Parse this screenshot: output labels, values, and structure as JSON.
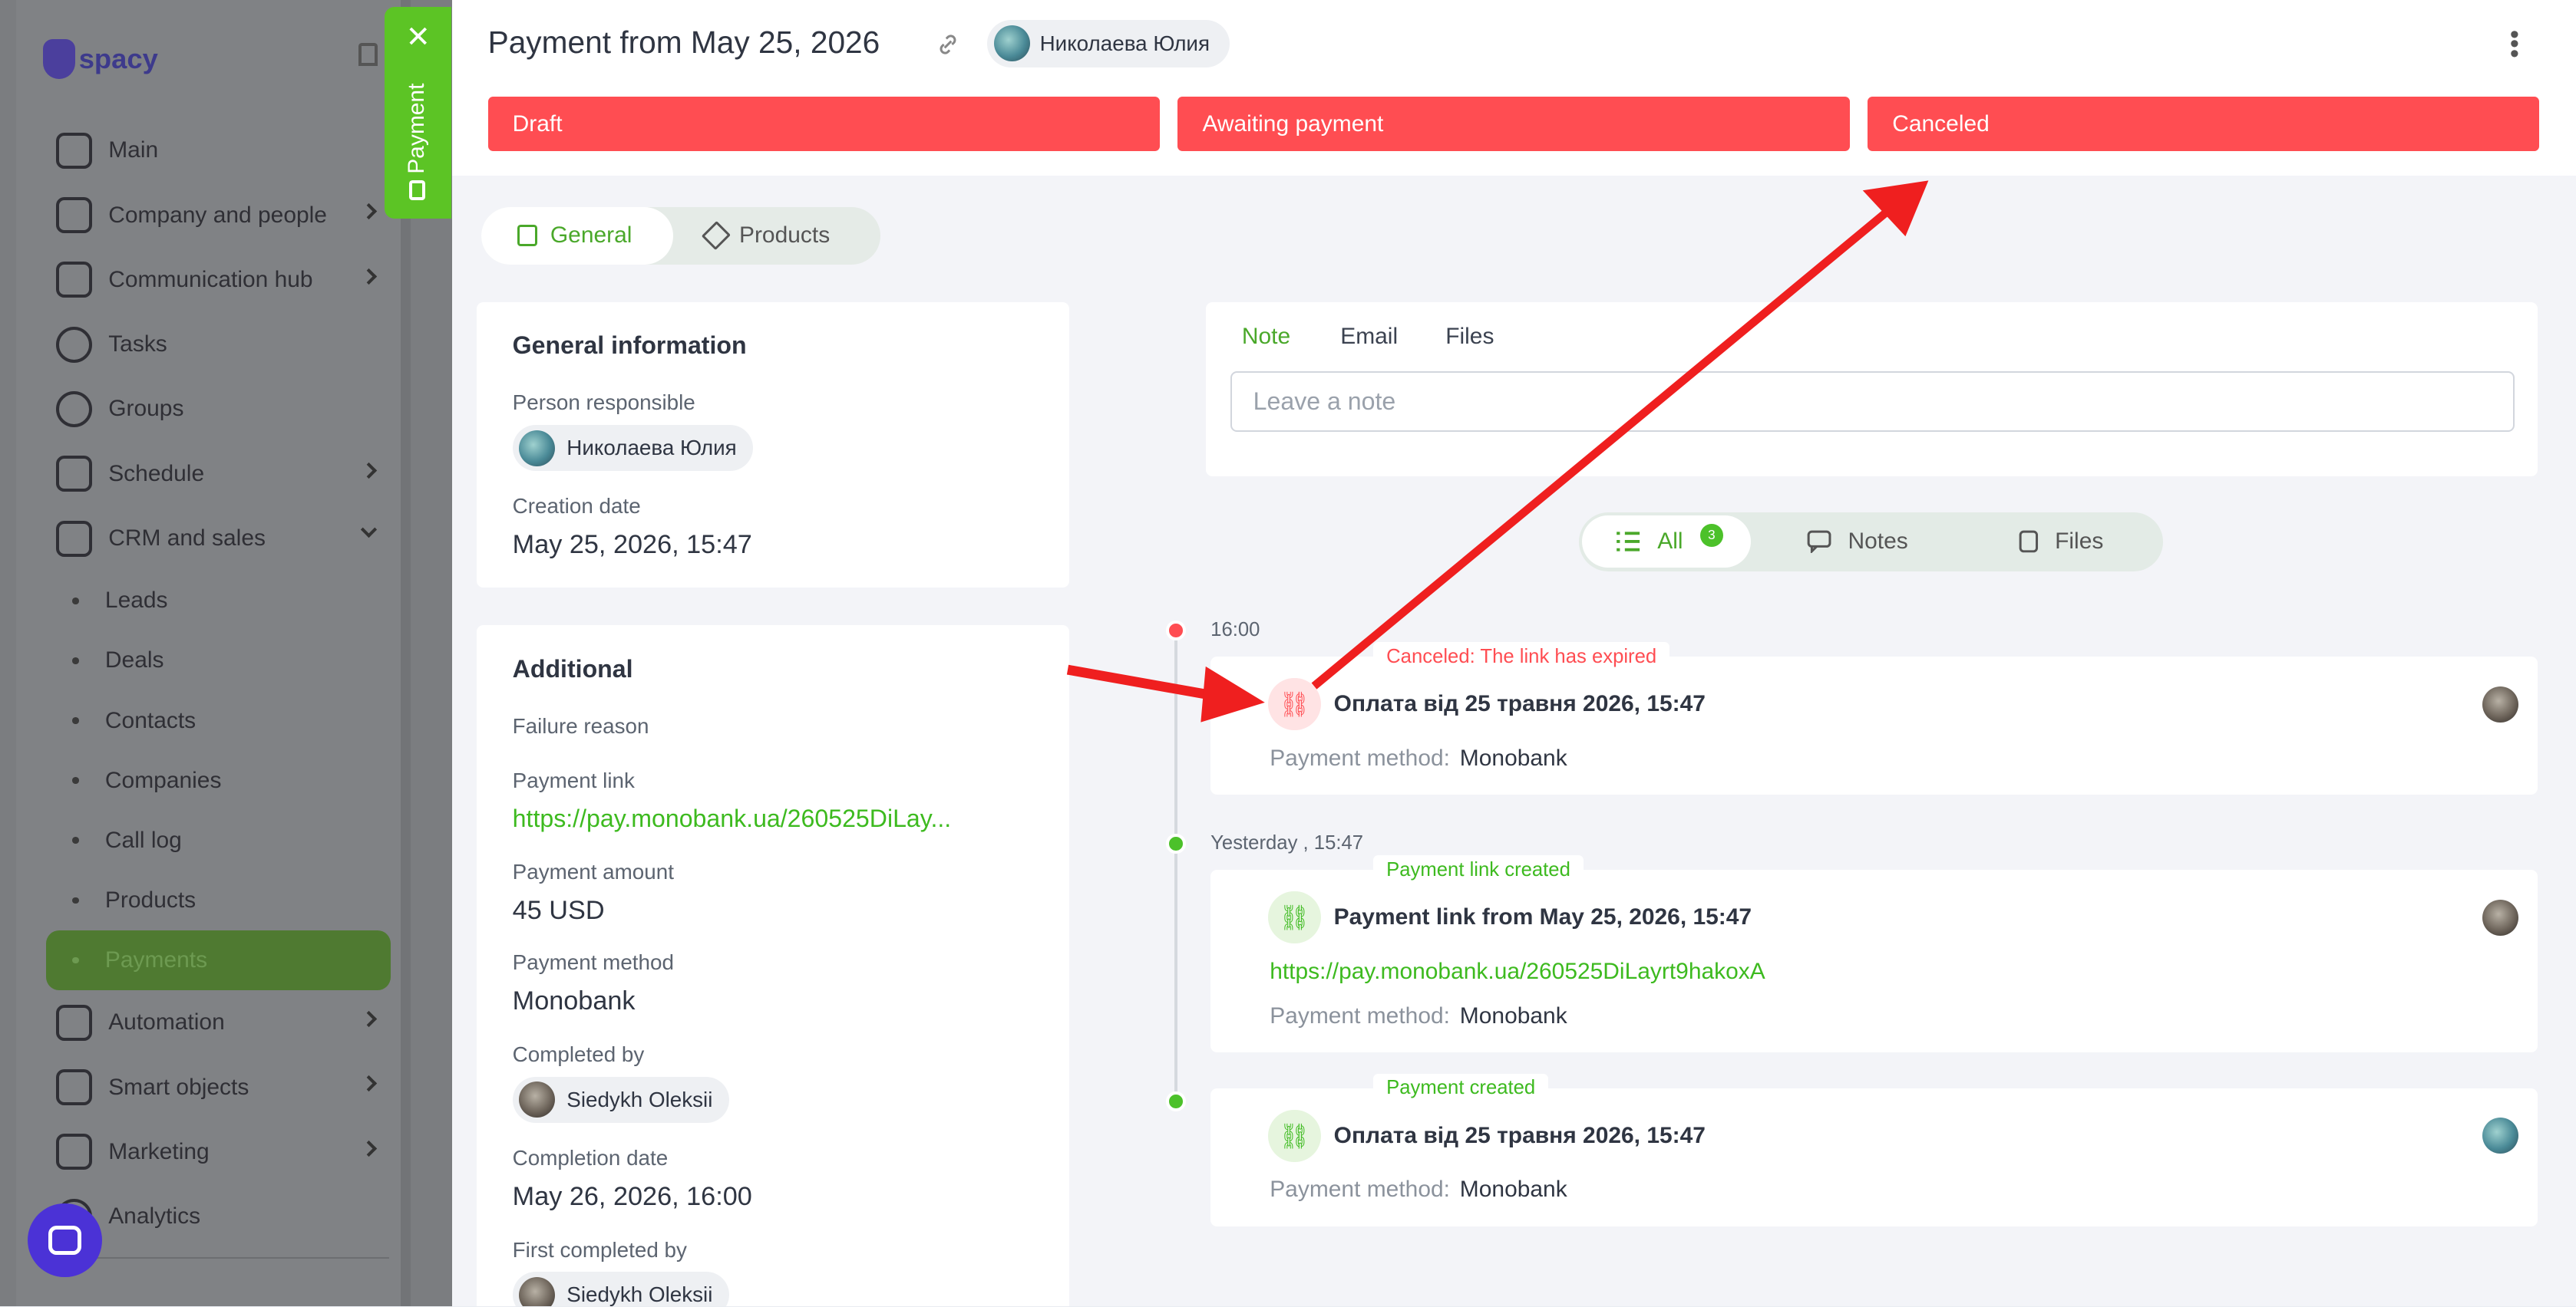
{
  "sidebar": {
    "logo": "spacy",
    "items": [
      {
        "label": "Main",
        "icon": "home-icon"
      },
      {
        "label": "Company and people",
        "icon": "building-icon"
      },
      {
        "label": "Communication hub",
        "icon": "chat-icon"
      },
      {
        "label": "Tasks",
        "icon": "check-circle-icon"
      },
      {
        "label": "Groups",
        "icon": "users-icon"
      },
      {
        "label": "Schedule",
        "icon": "calendar-icon"
      },
      {
        "label": "CRM and sales",
        "icon": "database-icon"
      }
    ],
    "crm_sub": [
      "Leads",
      "Deals",
      "Contacts",
      "Companies",
      "Call log",
      "Products",
      "Payments"
    ],
    "bottom_items": [
      {
        "label": "Automation",
        "icon": "bolt-icon"
      },
      {
        "label": "Smart objects",
        "icon": "scan-icon"
      },
      {
        "label": "Marketing",
        "icon": "megaphone-icon"
      },
      {
        "label": "Analytics",
        "icon": "chart-icon"
      }
    ]
  },
  "payment_tab": {
    "label": "Payment"
  },
  "header": {
    "title": "Payment from May 25, 2026",
    "responsible": "Николаева Юлия"
  },
  "stages": [
    "Draft",
    "Awaiting payment",
    "Canceled"
  ],
  "tabs": {
    "general": "General",
    "products": "Products"
  },
  "general": {
    "title": "General information",
    "person_label": "Person responsible",
    "person": "Николаева Юлия",
    "date_label": "Creation date",
    "date": "May 25, 2026, 15:47"
  },
  "additional": {
    "title": "Additional",
    "failure_label": "Failure reason",
    "link_label": "Payment link",
    "link": "https://pay.monobank.ua/260525DiLay...",
    "amount_label": "Payment amount",
    "amount": "45 USD",
    "method_label": "Payment method",
    "method": "Monobank",
    "completed_by_label": "Completed by",
    "completed_by": "Siedykh Oleksii",
    "completion_date_label": "Completion date",
    "completion_date": "May 26, 2026, 16:00",
    "first_completed_label": "First completed by",
    "first_completed": "Siedykh Oleksii"
  },
  "note": {
    "tabs": [
      "Note",
      "Email",
      "Files"
    ],
    "placeholder": "Leave a note"
  },
  "filter": {
    "all": "All",
    "all_count": "3",
    "notes": "Notes",
    "files": "Files"
  },
  "timeline": [
    {
      "time": "16:00",
      "tag": "Canceled: The link has expired",
      "title": "Оплата від 25 травня 2026, 15:47",
      "pm_label": "Payment method:",
      "pm": "Monobank"
    },
    {
      "time": "Yesterday , 15:47",
      "tag": "Payment link created",
      "title": "Payment link from May 25, 2026, 15:47",
      "link": "https://pay.monobank.ua/260525DiLayrt9hakoxA",
      "pm_label": "Payment method:",
      "pm": "Monobank"
    },
    {
      "tag": "Payment created",
      "title": "Оплата від 25 травня 2026, 15:47",
      "pm_label": "Payment method:",
      "pm": "Monobank"
    }
  ],
  "colors": {
    "stage_red": "#ff4d52",
    "accent_green": "#4cc12a",
    "arrow_red": "#ef1f1f"
  }
}
